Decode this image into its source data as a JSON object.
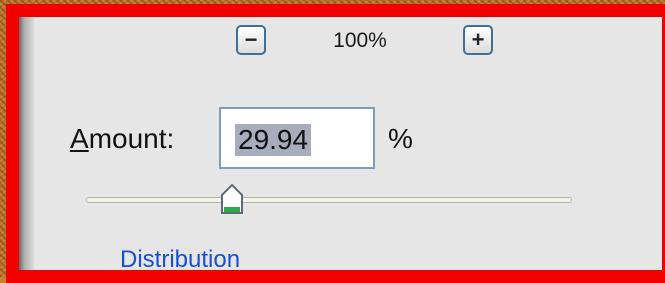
{
  "zoom": {
    "minus_label": "−",
    "plus_label": "+",
    "level": "100%"
  },
  "amount": {
    "label_accel": "A",
    "label_rest": "mount:",
    "value": "29.94",
    "unit": "%",
    "slider_fraction": 0.3
  },
  "distribution": {
    "label": "Distribution"
  },
  "colors": {
    "highlight_frame": "#f20000",
    "dialog_bg": "#e6e6e6",
    "link_blue": "#1a4dd6",
    "thumb_green": "#2aa84a"
  }
}
